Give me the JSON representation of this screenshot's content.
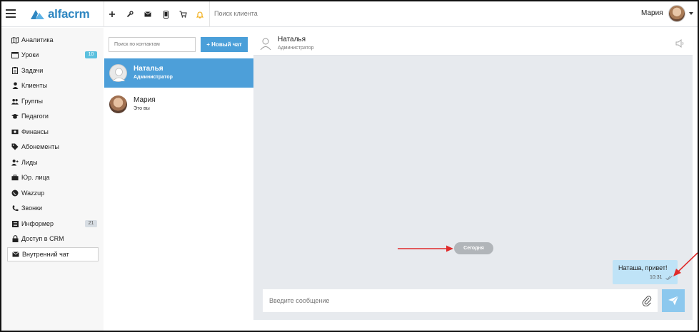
{
  "topbar": {
    "logo_text": "alfacrm",
    "search_placeholder": "Поиск клиента",
    "user_name": "Мария",
    "icons": [
      "plus-icon",
      "wrench-icon",
      "mail-icon",
      "phone-icon",
      "cart-icon",
      "bell-icon"
    ]
  },
  "sidebar": {
    "items": [
      {
        "label": "Аналитика",
        "icon": "map-icon"
      },
      {
        "label": "Уроки",
        "icon": "calendar-icon",
        "badge": "10"
      },
      {
        "label": "Задачи",
        "icon": "clipboard-icon"
      },
      {
        "label": "Клиенты",
        "icon": "user-icon"
      },
      {
        "label": "Группы",
        "icon": "users-icon"
      },
      {
        "label": "Педагоги",
        "icon": "graduation-cap-icon"
      },
      {
        "label": "Финансы",
        "icon": "money-icon"
      },
      {
        "label": "Абонементы",
        "icon": "tag-icon"
      },
      {
        "label": "Лиды",
        "icon": "user-plus-icon"
      },
      {
        "label": "Юр. лица",
        "icon": "briefcase-icon"
      },
      {
        "label": "Wazzup",
        "icon": "whatsapp-icon"
      },
      {
        "label": "Звонки",
        "icon": "phone-icon"
      },
      {
        "label": "Информер",
        "icon": "list-icon",
        "badge": "21"
      },
      {
        "label": "Доступ в CRM",
        "icon": "lock-icon"
      },
      {
        "label": "Внутренний чат",
        "icon": "envelope-icon"
      }
    ]
  },
  "contacts": {
    "search_placeholder": "Поиск по контактам",
    "new_chat_label": "+ Новый чат",
    "list": [
      {
        "name": "Наталья",
        "role": "Администратор"
      },
      {
        "name": "Мария",
        "role": "Это вы"
      }
    ]
  },
  "chat": {
    "header_name": "Наталья",
    "header_role": "Администратор",
    "date_label": "Сегодня",
    "message_text": "Наташа, привет!",
    "message_time": "10:31",
    "input_placeholder": "Введите сообщение"
  },
  "colors": {
    "accent": "#4a9fd9",
    "selected_contact": "#4d9fd9",
    "message_bubble": "#bfe3f7",
    "chat_background": "#e7eaee",
    "annotation_arrow": "#e02b2b"
  }
}
